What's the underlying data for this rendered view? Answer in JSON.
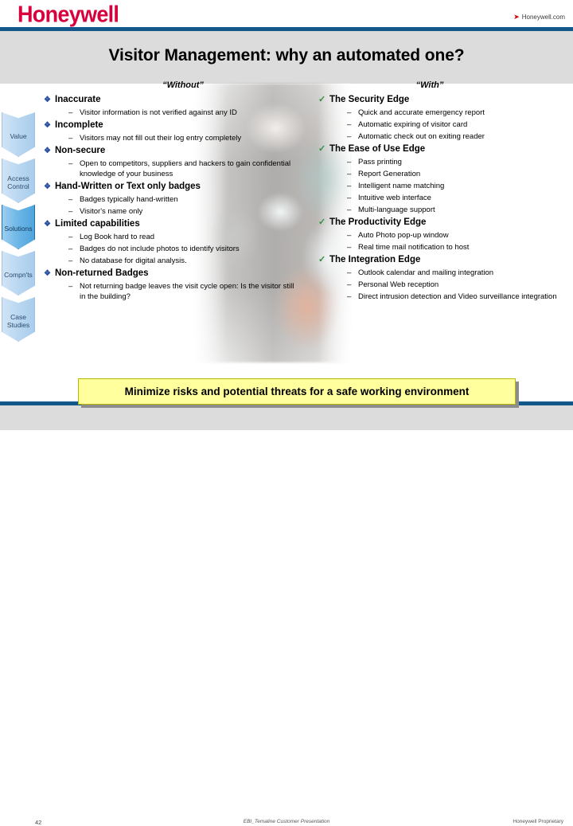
{
  "header": {
    "logo_text": "Honeywell",
    "link_icon": "arrow-right-icon",
    "link_text": "Honeywell.com",
    "bar_color": "#14578b",
    "logo_color": "#d8003c"
  },
  "slide": {
    "title": "Visitor Management: why an automated one?",
    "title_band_color": "#dcdcdc"
  },
  "sidebar": {
    "items": [
      {
        "label": "Value",
        "active": false
      },
      {
        "label": "Access\nControl",
        "active": false,
        "line1": "Access",
        "line2": "Control"
      },
      {
        "label": "Solutions",
        "active": true
      },
      {
        "label": "Compn'ts",
        "active": false
      },
      {
        "label": "Case\nStudies",
        "active": false,
        "line1": "Case",
        "line2": "Studies"
      }
    ],
    "active_color": "#4fa4dd"
  },
  "columns": {
    "left": {
      "heading": "“Without”",
      "marker_icon": "diamond-bullet-icon",
      "marker_glyph": "❖",
      "marker_color": "#2b4fa0",
      "groups": [
        {
          "title": "Inaccurate",
          "items": [
            "Visitor information is not verified against any ID"
          ]
        },
        {
          "title": "Incomplete",
          "items": [
            "Visitors may not fill out their log entry completely"
          ]
        },
        {
          "title": "Non-secure",
          "items": [
            "Open to competitors, suppliers and hackers to gain confidential knowledge of your business"
          ]
        },
        {
          "title": "Hand-Written or Text only badges",
          "items": [
            "Badges typically hand-written",
            "Visitor's name only"
          ]
        },
        {
          "title": "Limited capabilities",
          "items": [
            "Log Book hard to read",
            "Badges do not include photos to identify visitors",
            "No database for digital analysis."
          ]
        },
        {
          "title": "Non-returned Badges",
          "items": [
            "Not returning badge leaves the visit cycle open: Is the visitor still in the building?"
          ]
        }
      ]
    },
    "right": {
      "heading": "“With”",
      "marker_icon": "check-bullet-icon",
      "marker_glyph": "✓",
      "marker_color": "#2f8f3e",
      "groups": [
        {
          "title": "The Security Edge",
          "items": [
            "Quick and accurate emergency report",
            "Automatic expiring of visitor card",
            "Automatic check out on exiting reader"
          ]
        },
        {
          "title": "The Ease of Use Edge",
          "items": [
            "Pass printing",
            "Report Generation",
            "Intelligent name matching",
            "Intuitive web interface",
            "Multi-language support"
          ]
        },
        {
          "title": "The Productivity Edge",
          "items": [
            "Auto Photo pop-up window",
            "Real time mail notification to host"
          ]
        },
        {
          "title": "The Integration Edge",
          "items": [
            "Outlook calendar and mailing integration",
            "Personal Web reception",
            "Direct intrusion detection and Video surveillance integration"
          ]
        }
      ]
    }
  },
  "callout": {
    "text": "Minimize risks and potential threats for a safe working environment",
    "background": "#ffff9e"
  },
  "footer": {
    "page_number": "42",
    "center_text": "EBI_Temaline Customer Presentation",
    "right_text": "Honeywell Proprietary"
  }
}
